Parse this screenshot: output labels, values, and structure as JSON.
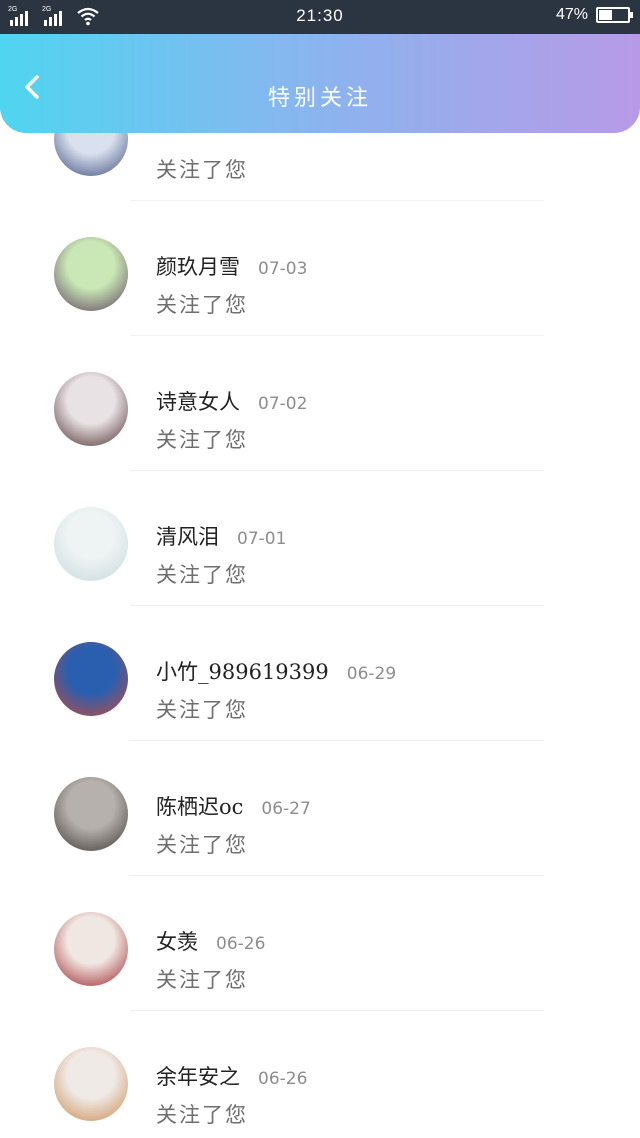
{
  "status_bar": {
    "sim1": "2G",
    "sim2": "2G",
    "time": "21:30",
    "battery_percent": "47%",
    "battery_level": 0.47
  },
  "header": {
    "title": "特别关注"
  },
  "list": [
    {
      "name": "",
      "date": "",
      "follow_text": "关注了您",
      "colors": [
        "#d9e1ee",
        "#3a4a7a"
      ]
    },
    {
      "name": "颜玖月雪",
      "date": "07-03",
      "follow_text": "关注了您",
      "colors": [
        "#c9e8b5",
        "#5a3d5c"
      ]
    },
    {
      "name": "诗意女人",
      "date": "07-02",
      "follow_text": "关注了您",
      "colors": [
        "#e9e2e4",
        "#4a2a2e"
      ]
    },
    {
      "name": "清风泪",
      "date": "07-01",
      "follow_text": "关注了您",
      "colors": [
        "#eef3f3",
        "#c6d9dc"
      ]
    },
    {
      "name": "小竹_989619399",
      "date": "06-29",
      "follow_text": "关注了您",
      "colors": [
        "#2a5fb0",
        "#c6493a"
      ]
    },
    {
      "name": "陈栖迟oc",
      "date": "06-27",
      "follow_text": "关注了您",
      "colors": [
        "#b7b1ae",
        "#3b3532"
      ]
    },
    {
      "name": "女羡",
      "date": "06-26",
      "follow_text": "关注了您",
      "colors": [
        "#f1e7e2",
        "#9a1f26"
      ]
    },
    {
      "name": "余年安之",
      "date": "06-26",
      "follow_text": "关注了您",
      "colors": [
        "#efeae6",
        "#c9874c"
      ]
    }
  ]
}
